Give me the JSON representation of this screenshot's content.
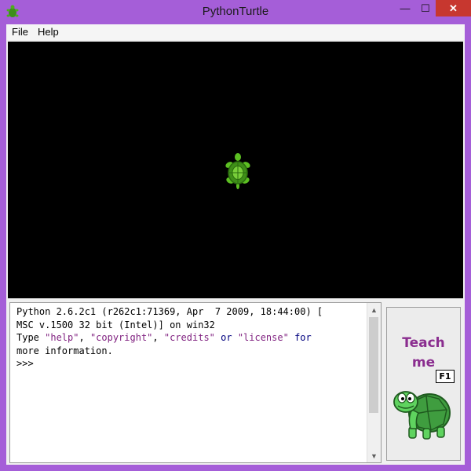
{
  "window": {
    "title": "PythonTurtle",
    "controls": {
      "minimize": "—",
      "maximize": "☐",
      "close": "✕"
    }
  },
  "menu": {
    "file": "File",
    "help": "Help"
  },
  "shell": {
    "line1": "Python 2.6.2c1 (r262c1:71369, Apr  7 2009, 18:44:00) [",
    "line2": "MSC v.1500 32 bit (Intel)] on win32",
    "line3_type": "Type ",
    "line3_help": "\"help\"",
    "line3_c1": ", ",
    "line3_copyright": "\"copyright\"",
    "line3_c2": ", ",
    "line3_credits": "\"credits\"",
    "line3_or": " or ",
    "line3_license": "\"license\"",
    "line3_for": " for",
    "line4": "more information.",
    "prompt": ">>>"
  },
  "teach": {
    "line1": "Teach",
    "line2": "me",
    "shortcut": "F1"
  },
  "colors": {
    "accent": "#a55ed8",
    "canvas": "#000000",
    "teach_text": "#8a2d8f",
    "turtle": "#4cae1c"
  },
  "icons": [
    "app-icon",
    "turtle-icon",
    "teach-turtle-icon"
  ]
}
